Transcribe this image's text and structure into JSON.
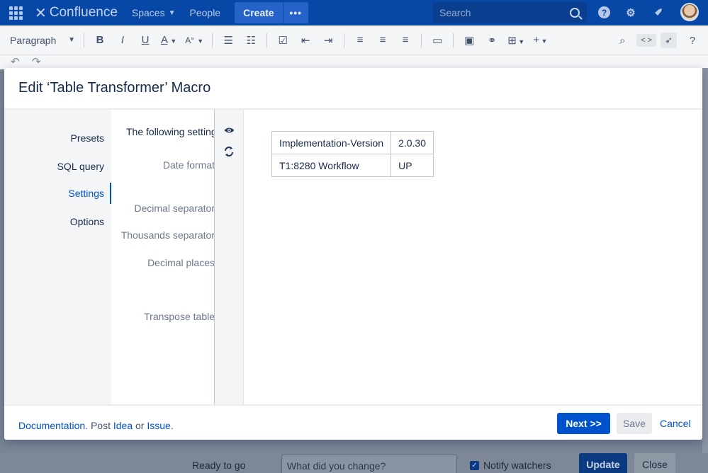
{
  "topnav": {
    "logo_text": "Confluence",
    "spaces_label": "Spaces",
    "people_label": "People",
    "create_label": "Create",
    "more_label": "•••",
    "search_placeholder": "Search",
    "help_label": "?",
    "brand_color": "#0747a6"
  },
  "toolbar": {
    "paragraph_label": "Paragraph",
    "bold": "B",
    "italic": "I",
    "underline": "U",
    "text_color": "A",
    "more_format": "A°",
    "code_label": "< >"
  },
  "modal": {
    "title": "Edit ‘Table Transformer’ Macro",
    "menu": [
      {
        "label": "Presets",
        "active": false
      },
      {
        "label": "SQL query",
        "active": false
      },
      {
        "label": "Settings",
        "active": true
      },
      {
        "label": "Options",
        "active": false
      }
    ],
    "settings": {
      "heading": "The following settings",
      "date_format": "Date format",
      "decimal_separator": "Decimal separator",
      "thousands_separator": "Thousands separator",
      "decimal_places": "Decimal places",
      "transpose_table": "Transpose table"
    },
    "preview_table": [
      [
        "Implementation-Version",
        "2.0.30"
      ],
      [
        "T1:8280 Workflow",
        "UP"
      ]
    ],
    "footer": {
      "documentation": "Documentation",
      "post": "Post",
      "idea": "Idea",
      "or": "or",
      "issue": "Issue",
      "next_label": "Next >>",
      "save_label": "Save",
      "cancel_label": "Cancel"
    }
  },
  "bottombar": {
    "status": "Ready to go",
    "change_placeholder": "What did you change?",
    "notify_label": "Notify watchers",
    "notify_checked": true,
    "update_label": "Update",
    "close_label": "Close"
  }
}
